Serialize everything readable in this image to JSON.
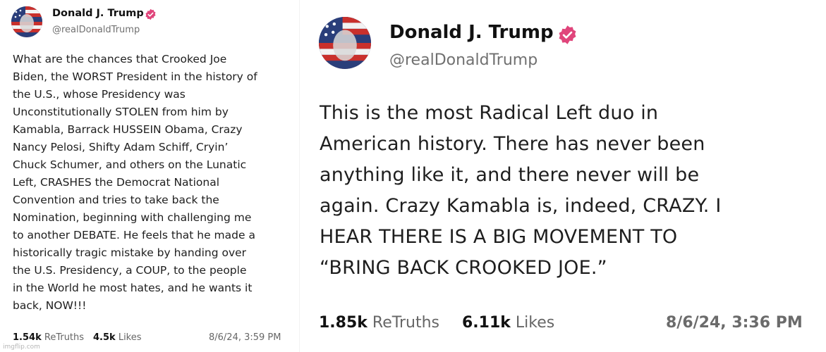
{
  "posts": [
    {
      "author": {
        "name": "Donald J. Trump",
        "handle": "@realDonaldTrump"
      },
      "body_lines": [
        "What are the chances that Crooked Joe",
        "Biden, the WORST President in the history of",
        "the U.S., whose Presidency was",
        "Unconstitutionally STOLEN from him by",
        "Kamabla, Barrack HUSSEIN Obama, Crazy",
        "Nancy Pelosi, Shifty Adam Schiff, Cryin’",
        "Chuck Schumer, and others on the Lunatic",
        "Left, CRASHES the Democrat National",
        "Convention and tries to take back the",
        "Nomination, beginning with challenging me",
        "to another DEBATE. He feels that he made a",
        "historically tragic mistake by handing over",
        "the U.S. Presidency, a COUP, to the people",
        "in the World he most hates, and he wants it",
        "back, NOW!!!"
      ],
      "stats": {
        "retruths_count": "1.54k",
        "retruths_label": "ReTruths",
        "likes_count": "4.5k",
        "likes_label": "Likes"
      },
      "timestamp": "8/6/24, 3:59 PM"
    },
    {
      "author": {
        "name": "Donald J. Trump",
        "handle": "@realDonaldTrump"
      },
      "body_lines": [
        "This is the most Radical Left duo in",
        "American history. There has never been",
        "anything like it, and there never will be",
        "again. Crazy Kamabla is, indeed, CRAZY. I",
        "HEAR THERE IS A BIG MOVEMENT TO",
        "“BRING BACK CROOKED JOE.”"
      ],
      "stats": {
        "retruths_count": "1.85k",
        "retruths_label": "ReTruths",
        "likes_count": "6.11k",
        "likes_label": "Likes"
      },
      "timestamp": "8/6/24, 3:36 PM"
    }
  ],
  "watermark": "imgflip.com",
  "colors": {
    "verified_badge": "#e0457b",
    "handle_gray": "#707070",
    "flag_blue": "#2a3e7a",
    "flag_red": "#c9302c"
  },
  "icons": {
    "verified": "verified-badge-icon"
  }
}
